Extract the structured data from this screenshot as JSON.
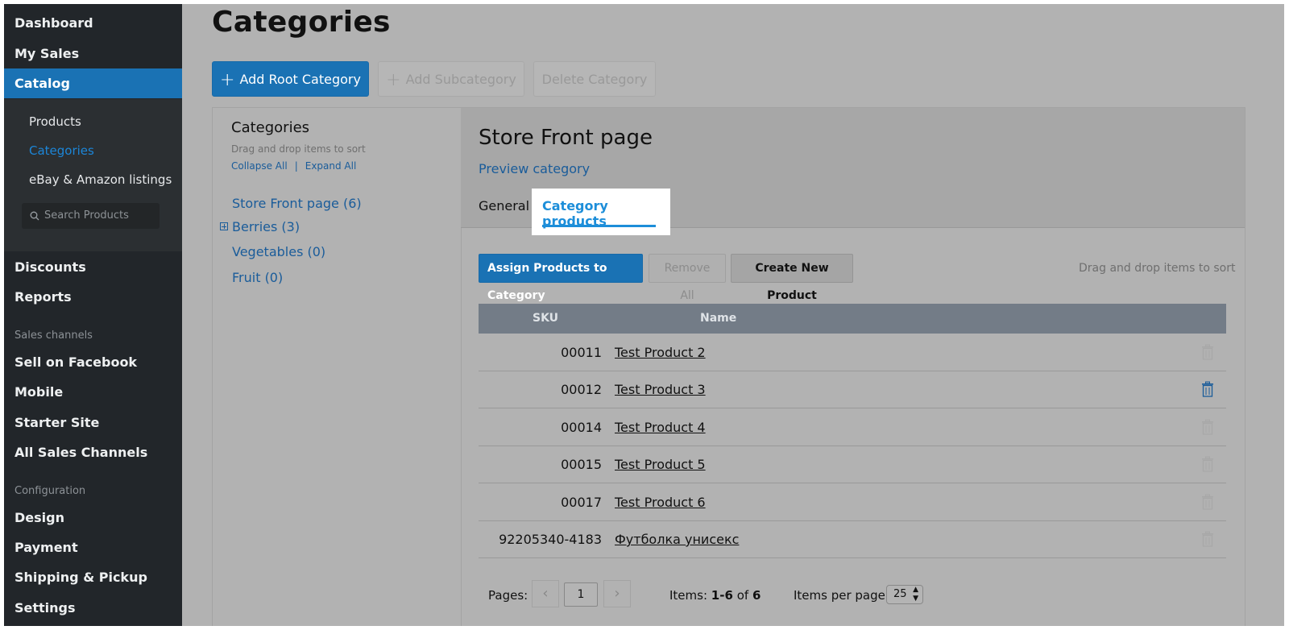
{
  "sidebar": {
    "top_items": [
      {
        "label": "Dashboard"
      },
      {
        "label": "My Sales"
      },
      {
        "label": "Catalog"
      }
    ],
    "catalog_sub": [
      {
        "label": "Products"
      },
      {
        "label": "Categories"
      },
      {
        "label": "eBay & Amazon listings"
      }
    ],
    "search_placeholder": "Search Products",
    "mid_items": [
      {
        "label": "Discounts"
      },
      {
        "label": "Reports"
      }
    ],
    "section_sales": "Sales channels",
    "sales_items": [
      {
        "label": "Sell on Facebook"
      },
      {
        "label": "Mobile"
      },
      {
        "label": "Starter Site"
      },
      {
        "label": "All Sales Channels"
      }
    ],
    "section_config": "Configuration",
    "config_items": [
      {
        "label": "Design"
      },
      {
        "label": "Payment"
      },
      {
        "label": "Shipping & Pickup"
      },
      {
        "label": "Settings"
      }
    ]
  },
  "page": {
    "title": "Categories",
    "toolbar": {
      "add_root": "Add Root Category",
      "add_sub": "Add Subcategory",
      "delete": "Delete Category"
    }
  },
  "tree": {
    "title": "Categories",
    "hint": "Drag and drop items to sort",
    "collapse_all": "Collapse All",
    "separator": "|",
    "expand_all": "Expand All",
    "items": [
      {
        "label": "Store Front page (6)"
      },
      {
        "label": "Berries (3)"
      },
      {
        "label": "Vegetables (0)"
      },
      {
        "label": "Fruit (0)"
      }
    ]
  },
  "detail": {
    "title": "Store Front page",
    "preview_link": "Preview category",
    "tabs": {
      "general": "General",
      "products": "Category products"
    },
    "actions": {
      "assign": "Assign Products to Category",
      "remove_all": "Remove All",
      "create": "Create New Product"
    },
    "drag_hint": "Drag and drop items to sort",
    "table": {
      "col_sku": "SKU",
      "col_name": "Name",
      "rows": [
        {
          "sku": "00011",
          "name": "Test Product 2"
        },
        {
          "sku": "00012",
          "name": "Test Product 3"
        },
        {
          "sku": "00014",
          "name": "Test Product 4"
        },
        {
          "sku": "00015",
          "name": "Test Product 5"
        },
        {
          "sku": "00017",
          "name": "Test Product 6"
        },
        {
          "sku": "92205340-4183",
          "name": "Футболка унисекс"
        }
      ]
    },
    "pager": {
      "pages_label": "Pages:",
      "current_page": "1",
      "items_label": "Items:",
      "items_range": "1-6",
      "items_of": "of",
      "items_total": "6",
      "per_page_label": "Items per page:",
      "per_page_value": "25"
    }
  },
  "colors": {
    "accent": "#1a72b4",
    "link": "#1a5c9a",
    "active_tab": "#1d8ed9",
    "sidebar_bg": "#22262a"
  }
}
